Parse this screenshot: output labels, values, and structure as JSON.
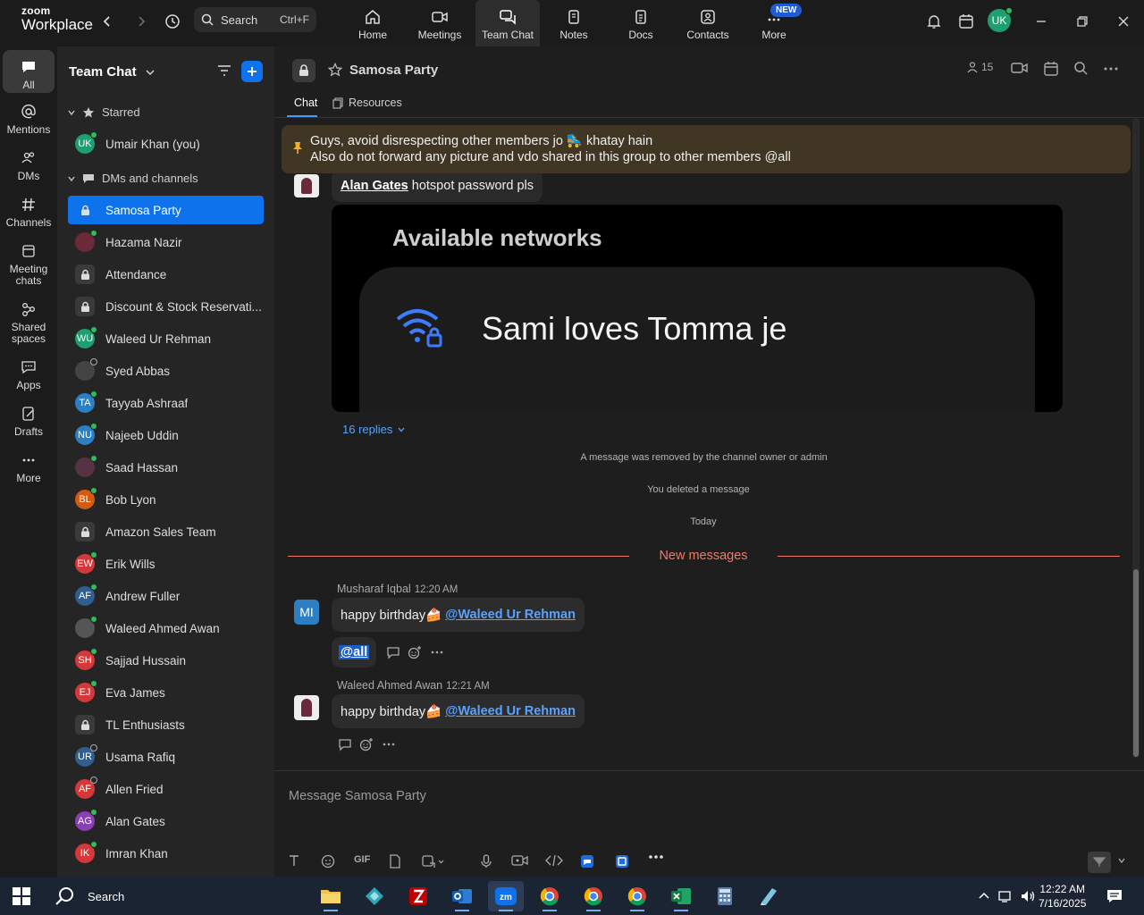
{
  "brand": {
    "line1": "zoom",
    "line2": "Workplace"
  },
  "search": {
    "label": "Search",
    "shortcut": "Ctrl+F"
  },
  "top_tabs": [
    {
      "label": "Home",
      "icon": "home-icon"
    },
    {
      "label": "Meetings",
      "icon": "video-camera-icon"
    },
    {
      "label": "Team Chat",
      "icon": "chat-icon"
    },
    {
      "label": "Notes",
      "icon": "notes-icon"
    },
    {
      "label": "Docs",
      "icon": "docs-icon"
    },
    {
      "label": "Contacts",
      "icon": "contacts-icon"
    },
    {
      "label": "More",
      "icon": "more-icon"
    }
  ],
  "new_badge": "NEW",
  "profile_initials": "UK",
  "rail": [
    {
      "label": "All",
      "icon": "chat-bubble-icon"
    },
    {
      "label": "Mentions",
      "icon": "at-icon"
    },
    {
      "label": "DMs",
      "icon": "people-icon"
    },
    {
      "label": "Channels",
      "icon": "hash-icon"
    },
    {
      "label": "Meeting chats",
      "icon": "calendar-icon"
    },
    {
      "label": "Shared spaces",
      "icon": "shared-icon"
    },
    {
      "label": "Apps",
      "icon": "apps-icon"
    },
    {
      "label": "Drafts",
      "icon": "drafts-icon"
    },
    {
      "label": "More",
      "icon": "ellipsis-icon"
    }
  ],
  "sidebar": {
    "title": "Team Chat",
    "starred_label": "Starred",
    "dms_label": "DMs and channels",
    "starred_item": {
      "initials": "UK",
      "name": "Umair Khan (you)",
      "color": "#1f9e6f"
    },
    "items": [
      {
        "name": "Samosa Party",
        "type": "lock",
        "color": "#0e72ed"
      },
      {
        "name": "Hazama Nazir",
        "type": "photo",
        "color": "#6b2a3a"
      },
      {
        "name": "Attendance",
        "type": "lock",
        "color": "#3a3a3a"
      },
      {
        "name": "Discount & Stock Reservati...",
        "type": "lock",
        "color": "#3a3a3a"
      },
      {
        "name": "Waleed Ur Rehman",
        "initials": "WU",
        "color": "#1f9e6f"
      },
      {
        "name": "Syed Abbas",
        "type": "photo",
        "color": "#444"
      },
      {
        "name": "Tayyab Ashraaf",
        "initials": "TA",
        "color": "#2b7fc2"
      },
      {
        "name": "Najeeb Uddin",
        "initials": "NU",
        "color": "#2b7fc2"
      },
      {
        "name": "Saad Hassan",
        "type": "photo",
        "color": "#553344"
      },
      {
        "name": "Bob Lyon",
        "initials": "BL",
        "color": "#d35a10"
      },
      {
        "name": "Amazon Sales Team",
        "type": "lock",
        "color": "#3a3a3a"
      },
      {
        "name": "Erik Wills",
        "initials": "EW",
        "color": "#d6383a"
      },
      {
        "name": "Andrew Fuller",
        "initials": "AF",
        "color": "#2f5e8f"
      },
      {
        "name": "Waleed Ahmed Awan",
        "type": "photo",
        "color": "#555"
      },
      {
        "name": "Sajjad Hussain",
        "initials": "SH",
        "color": "#d6383a"
      },
      {
        "name": "Eva James",
        "initials": "EJ",
        "color": "#d6383a"
      },
      {
        "name": "TL Enthusiasts",
        "type": "lock",
        "color": "#3a3a3a"
      },
      {
        "name": "Usama Rafiq",
        "initials": "UR",
        "color": "#2f5e8f"
      },
      {
        "name": "Allen Fried",
        "initials": "AF",
        "color": "#d6383a"
      },
      {
        "name": "Alan Gates",
        "initials": "AG",
        "color": "#8b3fb5"
      },
      {
        "name": "Imran Khan",
        "initials": "IK",
        "color": "#d6383a"
      }
    ]
  },
  "channel": {
    "title": "Samosa Party",
    "member_count": "15",
    "tabs": [
      "Chat",
      "Resources"
    ]
  },
  "pinned": {
    "line1": "Guys, avoid disrespecting other members jo 🛼 khatay hain",
    "line2": "Also do not forward any picture and vdo shared in this group to other members @all"
  },
  "messages": {
    "first": {
      "mention": "Alan Gates",
      "text": " hotspot password pls"
    },
    "image": {
      "heading": "Available networks",
      "network": "Sami loves Tomma je"
    },
    "replies": "16 replies",
    "removed": "A message was removed by the channel owner or admin",
    "deleted": "You deleted a message",
    "today": "Today",
    "new_messages": "New messages",
    "msg1": {
      "initials": "MI",
      "sender": "Musharaf Iqbal",
      "time": "12:20 AM",
      "text": "happy birthday🍰 ",
      "mention": "@Waleed Ur Rehman",
      "reaction": "@all"
    },
    "msg2": {
      "sender": "Waleed Ahmed Awan",
      "time": "12:21 AM",
      "text": "happy birthday🍰 ",
      "mention": "@Waleed Ur Rehman"
    }
  },
  "composer": {
    "placeholder": "Message Samosa Party",
    "gif": "GIF"
  },
  "taskbar": {
    "search": "Search",
    "time": "12:22 AM",
    "date": "7/16/2025"
  },
  "colors": {
    "accent": "#0e72ed",
    "pinned_bg": "#413624",
    "new_messages": "#f07a6a"
  }
}
